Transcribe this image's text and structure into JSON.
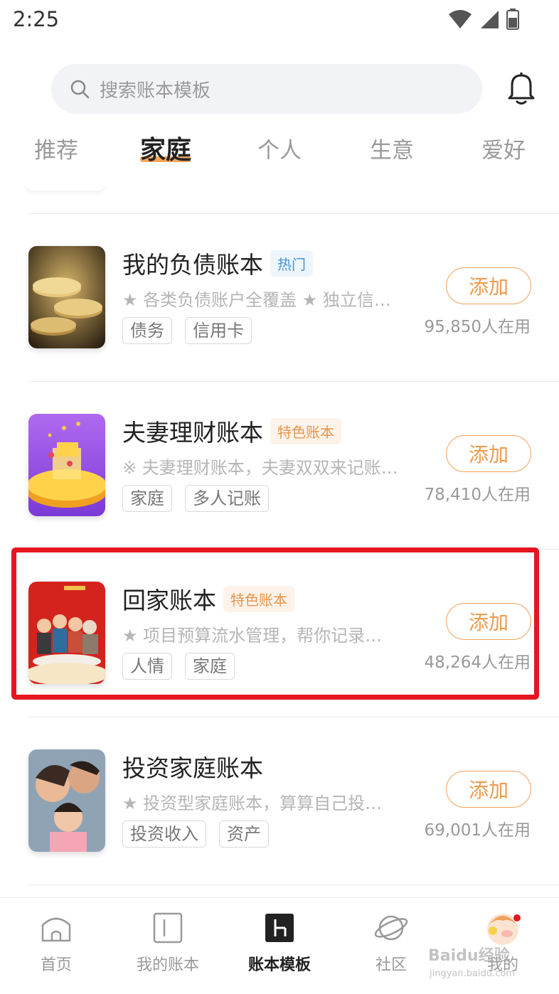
{
  "status_bar": {
    "time": "2:25"
  },
  "search": {
    "placeholder": "搜索账本模板"
  },
  "tabs": [
    {
      "label": "推荐",
      "active": false
    },
    {
      "label": "家庭",
      "active": true
    },
    {
      "label": "个人",
      "active": false
    },
    {
      "label": "生意",
      "active": false
    },
    {
      "label": "爱好",
      "active": false
    }
  ],
  "items": [
    {
      "title": "我的负债账本",
      "badge": "热门",
      "badge_type": "hot",
      "description": "★ 各类负债账户全覆盖 ★ 独立信…",
      "tags": [
        "债务",
        "信用卡"
      ],
      "button": "添加",
      "users": "95,850人在用",
      "image": "coins"
    },
    {
      "title": "夫妻理财账本",
      "badge": "特色账本",
      "badge_type": "feat",
      "description": "※ 夫妻理财账本，夫妻双双来记账…",
      "tags": [
        "家庭",
        "多人记账"
      ],
      "button": "添加",
      "users": "78,410人在用",
      "image": "treasure"
    },
    {
      "title": "回家账本",
      "badge": "特色账本",
      "badge_type": "feat",
      "description": "★ 项目预算流水管理，帮你记录…",
      "tags": [
        "人情",
        "家庭"
      ],
      "button": "添加",
      "users": "48,264人在用",
      "image": "family-dinner"
    },
    {
      "title": "投资家庭账本",
      "badge": "",
      "badge_type": "",
      "description": "★ 投资型家庭账本，算算自己投…",
      "tags": [
        "投资收入",
        "资产"
      ],
      "button": "添加",
      "users": "69,001人在用",
      "image": "family-photo"
    }
  ],
  "bottom_nav": [
    {
      "label": "首页",
      "icon": "home-icon",
      "active": false
    },
    {
      "label": "我的账本",
      "icon": "book-icon",
      "active": false
    },
    {
      "label": "账本模板",
      "icon": "template-icon",
      "active": true
    },
    {
      "label": "社区",
      "icon": "planet-icon",
      "active": false
    },
    {
      "label": "我的",
      "icon": "avatar-icon",
      "active": false
    }
  ],
  "watermark": {
    "line1": "Baidu经验",
    "line2": "jingyan.baidu.com"
  },
  "colors": {
    "accent": "#ef9a4e",
    "highlight": "#e5161f",
    "hot_badge": "#4a90d9"
  }
}
